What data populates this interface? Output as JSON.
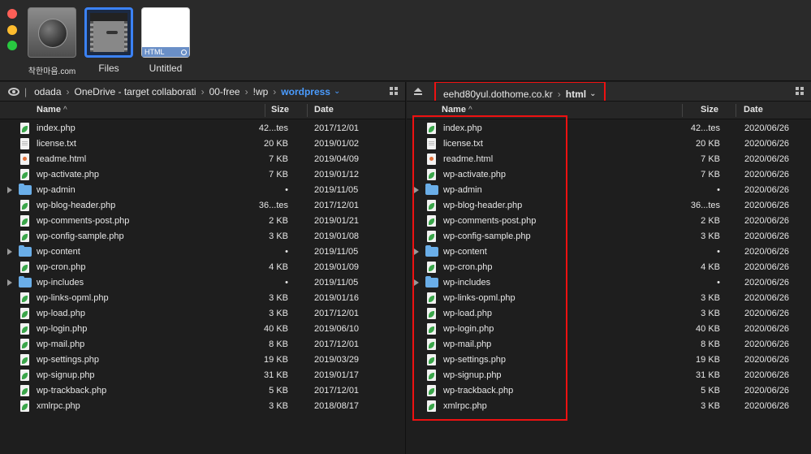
{
  "window": {
    "tiles": [
      {
        "caption": "착한마음.com",
        "kind": "site"
      },
      {
        "caption": "Files",
        "kind": "files"
      },
      {
        "caption": "Untitled",
        "kind": "html",
        "badge": "HTML"
      }
    ]
  },
  "left": {
    "breadcrumb": [
      "odada",
      "OneDrive - target collaborati",
      "00-free",
      "!wp",
      "wordpress"
    ],
    "columns": {
      "name": "Name",
      "size": "Size",
      "date": "Date"
    },
    "files": [
      {
        "name": "index.php",
        "type": "php",
        "size": "42...tes",
        "date": "2017/12/01"
      },
      {
        "name": "license.txt",
        "type": "txt",
        "size": "20 KB",
        "date": "2019/01/02"
      },
      {
        "name": "readme.html",
        "type": "html",
        "size": "7 KB",
        "date": "2019/04/09"
      },
      {
        "name": "wp-activate.php",
        "type": "php",
        "size": "7 KB",
        "date": "2019/01/12"
      },
      {
        "name": "wp-admin",
        "type": "folder",
        "size": "•",
        "date": "2019/11/05"
      },
      {
        "name": "wp-blog-header.php",
        "type": "php",
        "size": "36...tes",
        "date": "2017/12/01"
      },
      {
        "name": "wp-comments-post.php",
        "type": "php",
        "size": "2 KB",
        "date": "2019/01/21"
      },
      {
        "name": "wp-config-sample.php",
        "type": "php",
        "size": "3 KB",
        "date": "2019/01/08"
      },
      {
        "name": "wp-content",
        "type": "folder",
        "size": "•",
        "date": "2019/11/05"
      },
      {
        "name": "wp-cron.php",
        "type": "php",
        "size": "4 KB",
        "date": "2019/01/09"
      },
      {
        "name": "wp-includes",
        "type": "folder",
        "size": "•",
        "date": "2019/11/05"
      },
      {
        "name": "wp-links-opml.php",
        "type": "php",
        "size": "3 KB",
        "date": "2019/01/16"
      },
      {
        "name": "wp-load.php",
        "type": "php",
        "size": "3 KB",
        "date": "2017/12/01"
      },
      {
        "name": "wp-login.php",
        "type": "php",
        "size": "40 KB",
        "date": "2019/06/10"
      },
      {
        "name": "wp-mail.php",
        "type": "php",
        "size": "8 KB",
        "date": "2017/12/01"
      },
      {
        "name": "wp-settings.php",
        "type": "php",
        "size": "19 KB",
        "date": "2019/03/29"
      },
      {
        "name": "wp-signup.php",
        "type": "php",
        "size": "31 KB",
        "date": "2019/01/17"
      },
      {
        "name": "wp-trackback.php",
        "type": "php",
        "size": "5 KB",
        "date": "2017/12/01"
      },
      {
        "name": "xmlrpc.php",
        "type": "php",
        "size": "3 KB",
        "date": "2018/08/17"
      }
    ]
  },
  "right": {
    "server": "eehd80yul.dothome.co.kr",
    "folder": "html",
    "columns": {
      "name": "Name",
      "size": "Size",
      "date": "Date"
    },
    "files": [
      {
        "name": "index.php",
        "type": "php",
        "size": "42...tes",
        "date": "2020/06/26"
      },
      {
        "name": "license.txt",
        "type": "txt",
        "size": "20 KB",
        "date": "2020/06/26"
      },
      {
        "name": "readme.html",
        "type": "html",
        "size": "7 KB",
        "date": "2020/06/26"
      },
      {
        "name": "wp-activate.php",
        "type": "php",
        "size": "7 KB",
        "date": "2020/06/26"
      },
      {
        "name": "wp-admin",
        "type": "folder",
        "size": "•",
        "date": "2020/06/26"
      },
      {
        "name": "wp-blog-header.php",
        "type": "php",
        "size": "36...tes",
        "date": "2020/06/26"
      },
      {
        "name": "wp-comments-post.php",
        "type": "php",
        "size": "2 KB",
        "date": "2020/06/26"
      },
      {
        "name": "wp-config-sample.php",
        "type": "php",
        "size": "3 KB",
        "date": "2020/06/26"
      },
      {
        "name": "wp-content",
        "type": "folder",
        "size": "•",
        "date": "2020/06/26"
      },
      {
        "name": "wp-cron.php",
        "type": "php",
        "size": "4 KB",
        "date": "2020/06/26"
      },
      {
        "name": "wp-includes",
        "type": "folder",
        "size": "•",
        "date": "2020/06/26"
      },
      {
        "name": "wp-links-opml.php",
        "type": "php",
        "size": "3 KB",
        "date": "2020/06/26"
      },
      {
        "name": "wp-load.php",
        "type": "php",
        "size": "3 KB",
        "date": "2020/06/26"
      },
      {
        "name": "wp-login.php",
        "type": "php",
        "size": "40 KB",
        "date": "2020/06/26"
      },
      {
        "name": "wp-mail.php",
        "type": "php",
        "size": "8 KB",
        "date": "2020/06/26"
      },
      {
        "name": "wp-settings.php",
        "type": "php",
        "size": "19 KB",
        "date": "2020/06/26"
      },
      {
        "name": "wp-signup.php",
        "type": "php",
        "size": "31 KB",
        "date": "2020/06/26"
      },
      {
        "name": "wp-trackback.php",
        "type": "php",
        "size": "5 KB",
        "date": "2020/06/26"
      },
      {
        "name": "xmlrpc.php",
        "type": "php",
        "size": "3 KB",
        "date": "2020/06/26"
      }
    ]
  },
  "colors": {
    "accent": "#4a9cff",
    "annotation": "#e11111",
    "folder": "#6aaee8",
    "php": "#3aa64a"
  }
}
